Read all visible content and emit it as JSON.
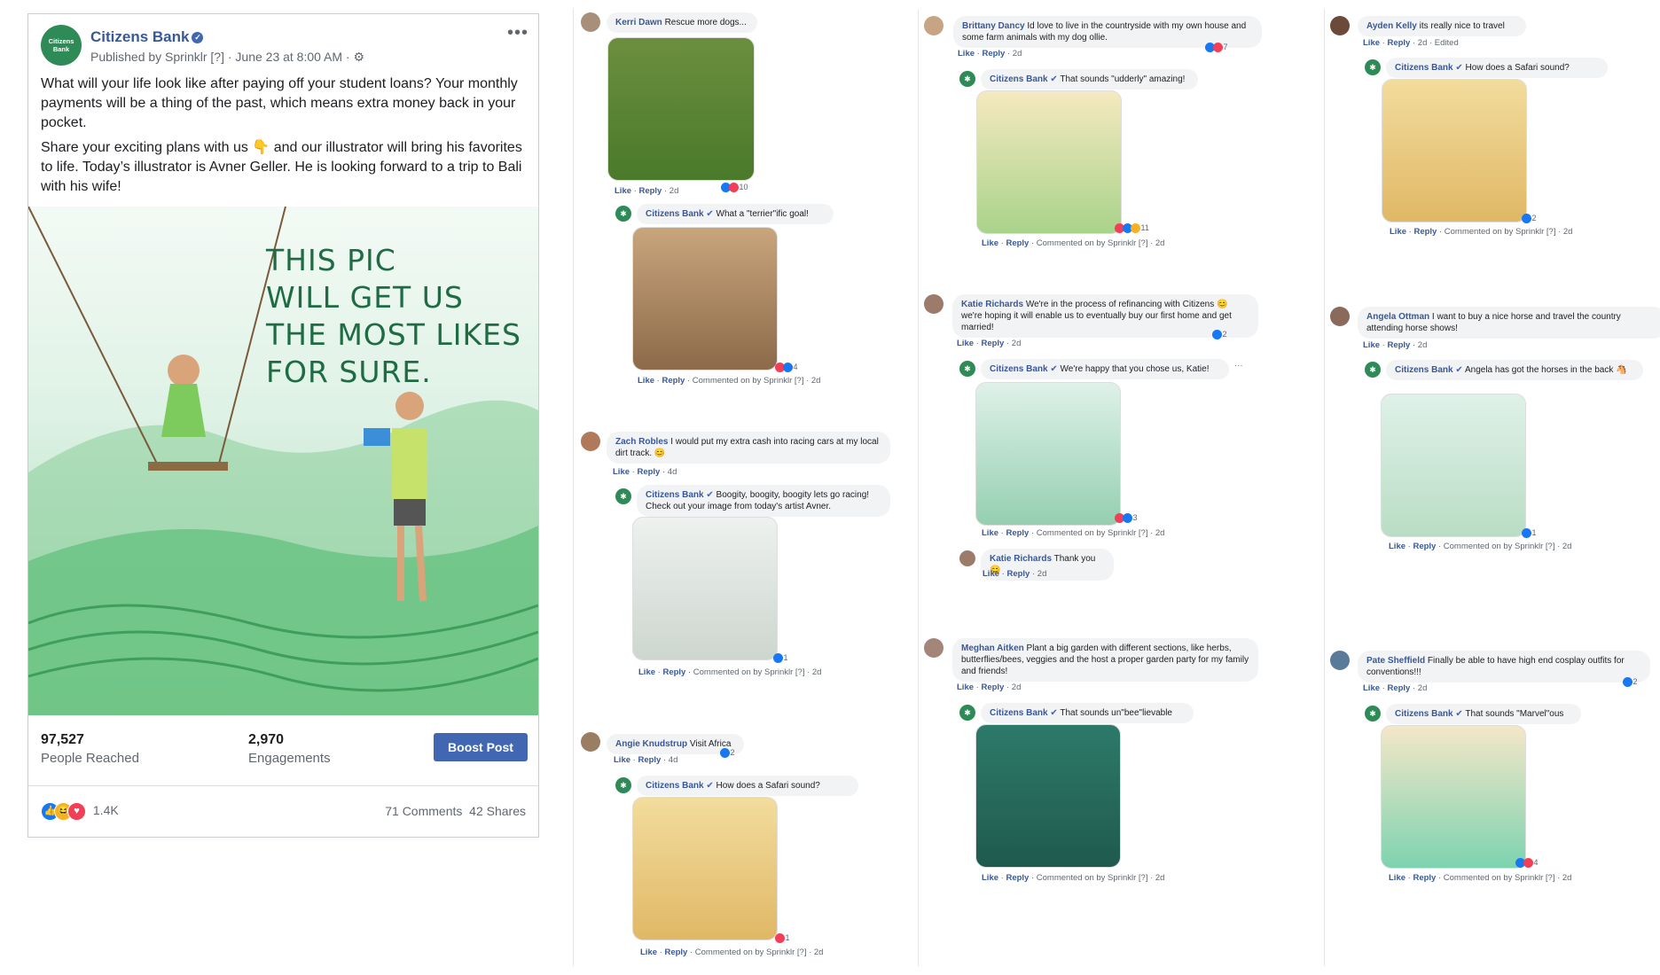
{
  "post": {
    "page_name": "Citizens Bank",
    "logo_text": "Citizens Bank",
    "meta": "Published by Sprinklr [?] · June 23 at 8:00 AM ·",
    "more_icon": "ellipsis-icon",
    "paragraph1": "What will your life look like after paying off your student loans? Your monthly payments will be a thing of the past, which means extra money back in your pocket.",
    "paragraph2": "Share your exciting plans with us 👇 and our illustrator will bring his favorites to life. Today’s illustrator is Avner Geller. He is looking forward to a trip to Bali with his wife!",
    "art_caption_lines": [
      "THIS PIC",
      "WILL GET US",
      "THE MOST LIKES",
      "FOR SURE."
    ],
    "people_reached": "97,527",
    "people_reached_label": "People Reached",
    "engagements": "2,970",
    "engagements_label": "Engagements",
    "boost_label": "Boost Post",
    "reactions_count": "1.4K",
    "comments": "71 Comments",
    "shares": "42 Shares"
  },
  "comments": {
    "kerri": {
      "author": "Kerri Dawn",
      "text": "Rescue more dogs...",
      "like": "Like",
      "reply": "Reply",
      "time": "· 2d",
      "reacts": "10"
    },
    "kerri_reply": {
      "author": "Citizens Bank",
      "text": "What a \"terrier\"ific goal!",
      "like": "Like",
      "reply": "Reply",
      "meta": "· Commented on by Sprinklr [?] · 2d",
      "reacts": "4"
    },
    "zach": {
      "author": "Zach Robles",
      "text": "I would put my extra cash into racing cars at my local dirt track. 😊",
      "like": "Like",
      "reply": "Reply",
      "time": "· 4d"
    },
    "zach_reply": {
      "author": "Citizens Bank",
      "text": "Boogity, boogity, boogity lets go racing! Check out your image from today's artist Avner.",
      "like": "Like",
      "reply": "Reply",
      "meta": "· Commented on by Sprinklr [?] · 2d",
      "reacts": "1"
    },
    "angie": {
      "author": "Angie Knudstrup",
      "text": "Visit Africa",
      "like": "Like",
      "reply": "Reply",
      "time": "· 4d",
      "reacts": "2"
    },
    "angie_reply": {
      "author": "Citizens Bank",
      "text": "How does a Safari sound?",
      "like": "Like",
      "reply": "Reply",
      "meta": "· Commented on by Sprinklr [?] · 2d",
      "reacts": "1"
    },
    "brittany": {
      "author": "Brittany Dancy",
      "text": "Id love to live in the countryside with my own house and some farm animals with my dog ollie.",
      "like": "Like",
      "reply": "Reply",
      "time": "· 2d",
      "reacts": "7"
    },
    "brittany_reply": {
      "author": "Citizens Bank",
      "text": "That sounds \"udderly\" amazing!",
      "like": "Like",
      "reply": "Reply",
      "meta": "· Commented on by Sprinklr [?] · 2d",
      "reacts": "11"
    },
    "katie": {
      "author": "Katie Richards",
      "text": "We're in the process of refinancing with Citizens 😊 we're hoping it will enable us to eventually buy our first home and get married!",
      "like": "Like",
      "reply": "Reply",
      "time": "· 2d",
      "reacts": "2"
    },
    "katie_reply": {
      "author": "Citizens Bank",
      "text": "We're happy that you chose us, Katie!",
      "like": "Like",
      "reply": "Reply",
      "meta": "· Commented on by Sprinklr [?] · 2d",
      "reacts": "3"
    },
    "katie2": {
      "author": "Katie Richards",
      "text": "Thank you 😊",
      "like": "Like",
      "reply": "Reply",
      "time": "· 2d"
    },
    "meghan": {
      "author": "Meghan Aitken",
      "text": "Plant a big garden with different sections, like herbs, butterflies/bees, veggies and the host a proper garden party for my family and friends!",
      "like": "Like",
      "reply": "Reply",
      "time": "· 2d"
    },
    "meghan_reply": {
      "author": "Citizens Bank",
      "text": "That sounds un\"bee\"lievable",
      "like": "Like",
      "reply": "Reply",
      "meta": "· Commented on by Sprinklr [?] · 2d"
    },
    "ayden": {
      "author": "Ayden Kelly",
      "text": "its really nice to travel",
      "like": "Like",
      "reply": "Reply",
      "time": "· 2d · Edited"
    },
    "ayden_reply": {
      "author": "Citizens Bank",
      "text": "How does a Safari sound?",
      "like": "Like",
      "reply": "Reply",
      "meta": "· Commented on by Sprinklr [?] · 2d",
      "reacts": "2"
    },
    "angela": {
      "author": "Angela Ottman",
      "text": "I want to buy a nice horse and travel the country attending horse shows!",
      "like": "Like",
      "reply": "Reply",
      "time": "· 2d"
    },
    "angela_reply": {
      "author": "Citizens Bank",
      "text": "Angela has got the horses in the back 🐴",
      "like": "Like",
      "reply": "Reply",
      "meta": "· Commented on by Sprinklr [?] · 2d",
      "reacts": "1"
    },
    "pate": {
      "author": "Pate Sheffield",
      "text": "Finally be able to have high end cosplay outfits for conventions!!!",
      "like": "Like",
      "reply": "Reply",
      "time": "· 2d",
      "reacts": "2"
    },
    "pate_reply": {
      "author": "Citizens Bank",
      "text": "That sounds \"Marvel\"ous",
      "like": "Like",
      "reply": "Reply",
      "meta": "· Commented on by Sprinklr [?] · 2d",
      "reacts": "4"
    }
  },
  "colors": {
    "brand": "#2e8b57",
    "link": "#385898",
    "boost": "#4267b2"
  }
}
